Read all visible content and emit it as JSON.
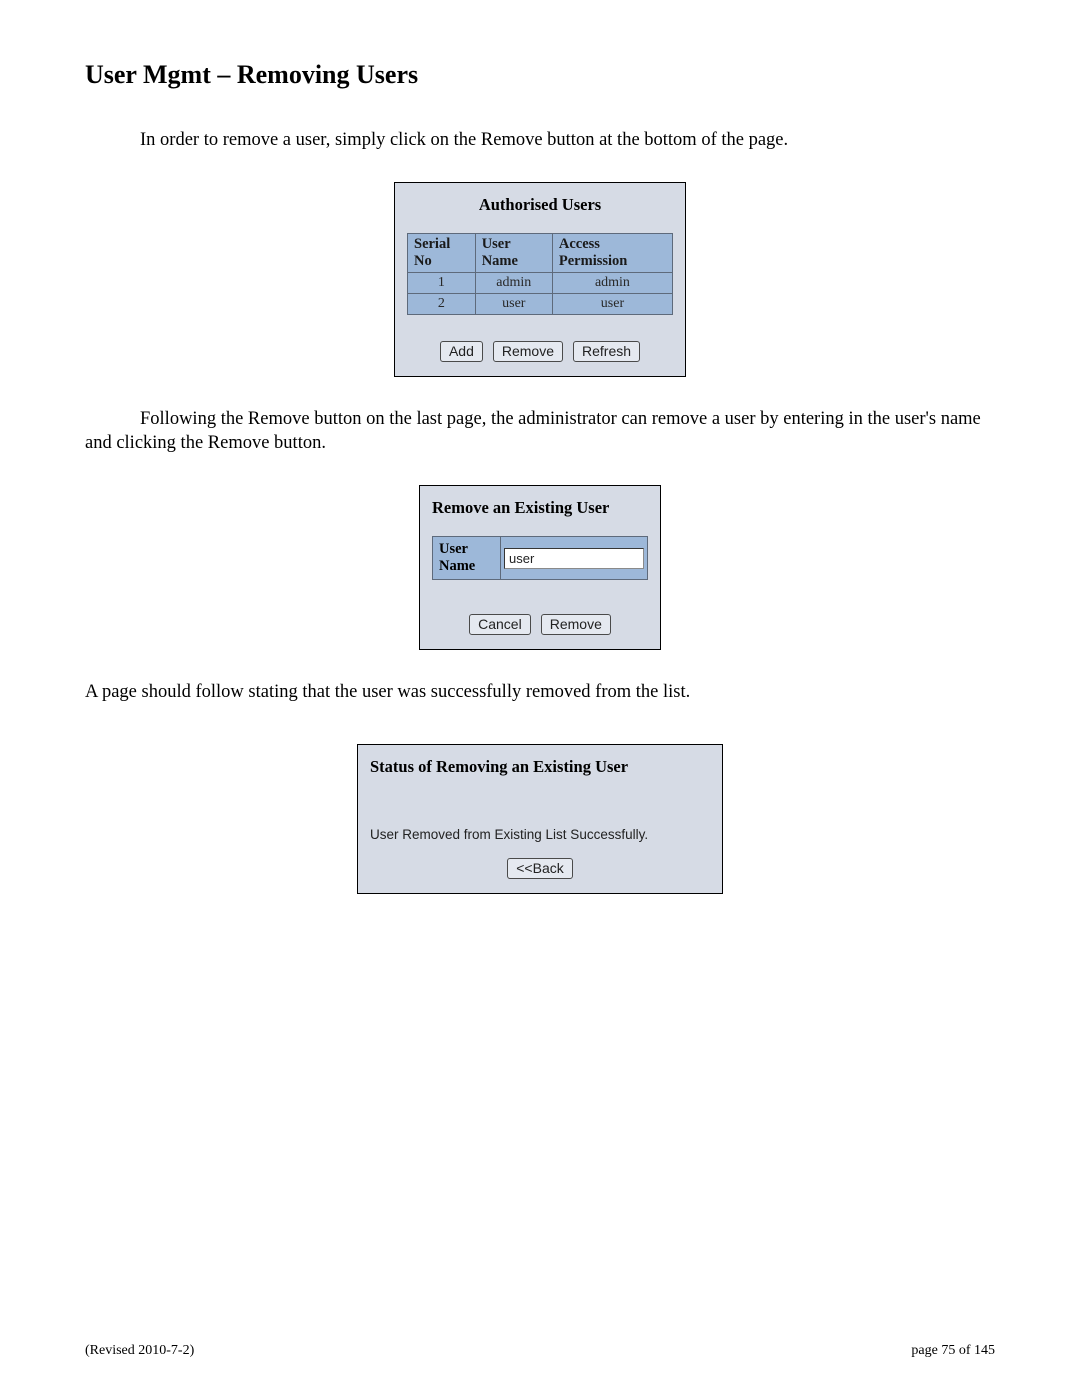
{
  "heading": "User Mgmt – Removing Users",
  "para1": "In order to remove a user, simply click on the Remove button at the bottom of the page.",
  "authorisedUsers": {
    "title": "Authorised Users",
    "columns": [
      "Serial No",
      "User Name",
      "Access Permission"
    ],
    "rows": [
      {
        "serial": "1",
        "name": "admin",
        "access": "admin"
      },
      {
        "serial": "2",
        "name": "user",
        "access": "user"
      }
    ],
    "buttons": {
      "add": "Add",
      "remove": "Remove",
      "refresh": "Refresh"
    }
  },
  "para2": "Following the Remove button on the last page, the administrator can remove a user by entering in the user's name and clicking the Remove button.",
  "removeUser": {
    "title": "Remove an Existing User",
    "fieldLabel": "User Name",
    "fieldValue": "user",
    "buttons": {
      "cancel": "Cancel",
      "remove": "Remove"
    }
  },
  "para3": "A page should follow stating that the user was successfully removed from the list.",
  "status": {
    "title": "Status of Removing an Existing User",
    "message": "User Removed from Existing List Successfully.",
    "backButton": "<<Back"
  },
  "footer": {
    "left": "(Revised 2010-7-2)",
    "right": "page 75 of 145"
  }
}
